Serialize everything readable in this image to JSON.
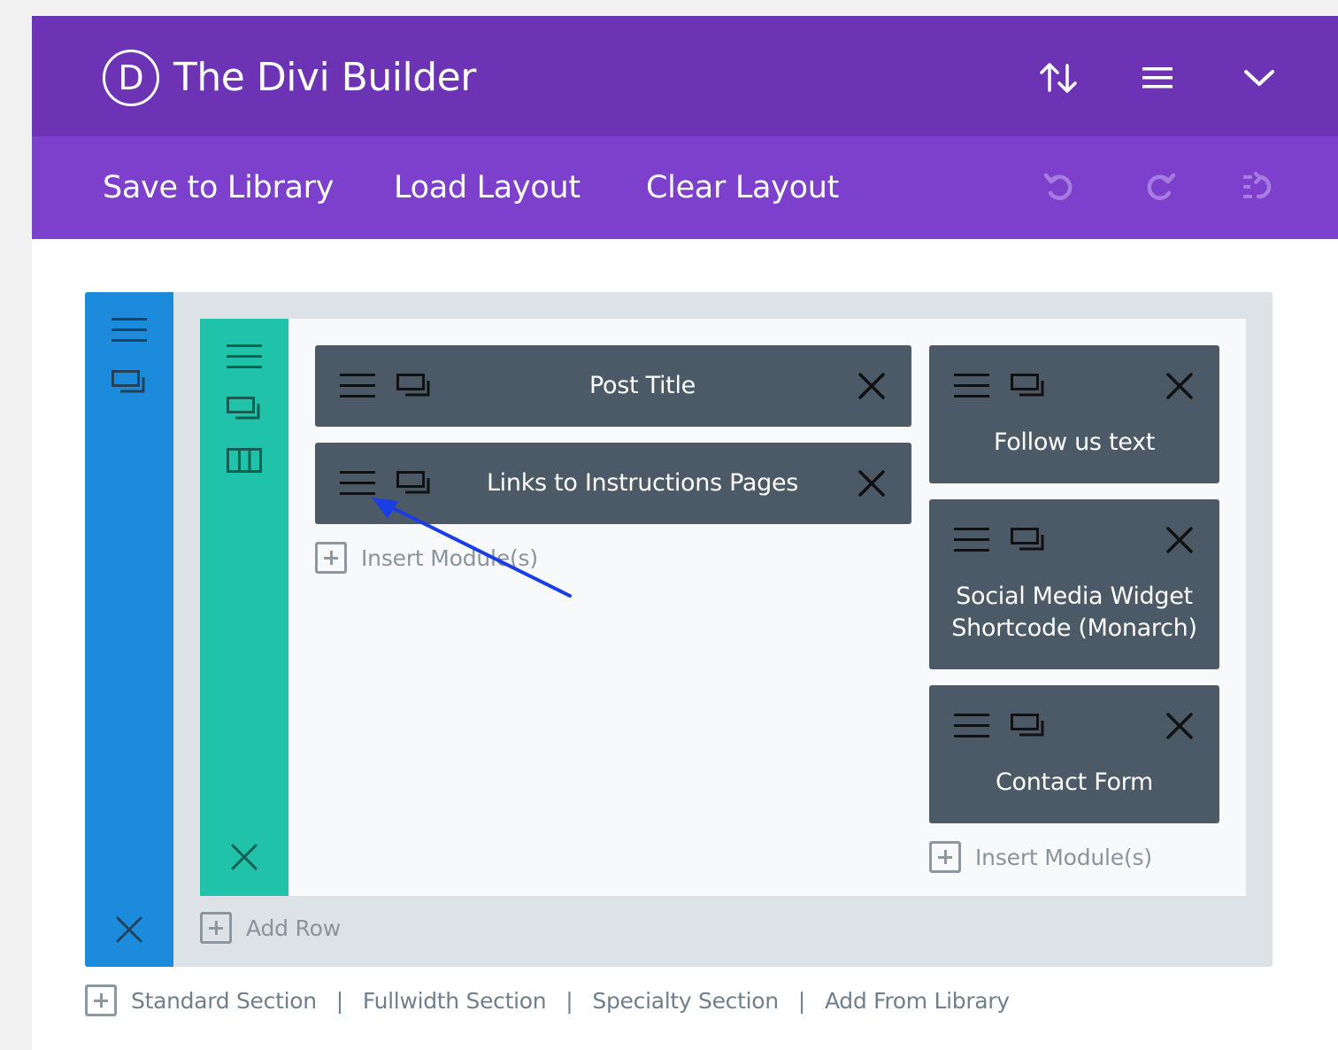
{
  "app": {
    "logo_letter": "D",
    "title": "The Divi Builder"
  },
  "header_icons": [
    "sort-arrows-icon",
    "menu-icon",
    "chevron-down-icon"
  ],
  "toolbar": {
    "save_label": "Save to Library",
    "load_label": "Load Layout",
    "clear_label": "Clear Layout",
    "history_icons": [
      "undo-icon",
      "redo-icon",
      "history-icon"
    ]
  },
  "colors": {
    "header_top": "#6c34b4",
    "header_bar": "#7c40cc",
    "section_rail": "#1c8bdb",
    "row_rail": "#20c2aa",
    "module_bg": "#4b5a66",
    "annotation_arrow": "#1a3ee6"
  },
  "section": {
    "row": {
      "columns": [
        {
          "modules": [
            {
              "title": "Post Title"
            },
            {
              "title": "Links to Instructions Pages"
            }
          ],
          "insert_label": "Insert Module(s)"
        },
        {
          "modules": [
            {
              "title": "Follow us text"
            },
            {
              "title_line1": "Social Media Widget",
              "title_line2": "Shortcode (Monarch)"
            },
            {
              "title": "Contact Form"
            }
          ],
          "insert_label": "Insert Module(s)"
        }
      ]
    },
    "add_row_label": "Add Row"
  },
  "footer": {
    "standard": "Standard Section",
    "fullwidth": "Fullwidth Section",
    "specialty": "Specialty Section",
    "library": "Add From Library",
    "separator": "|"
  }
}
